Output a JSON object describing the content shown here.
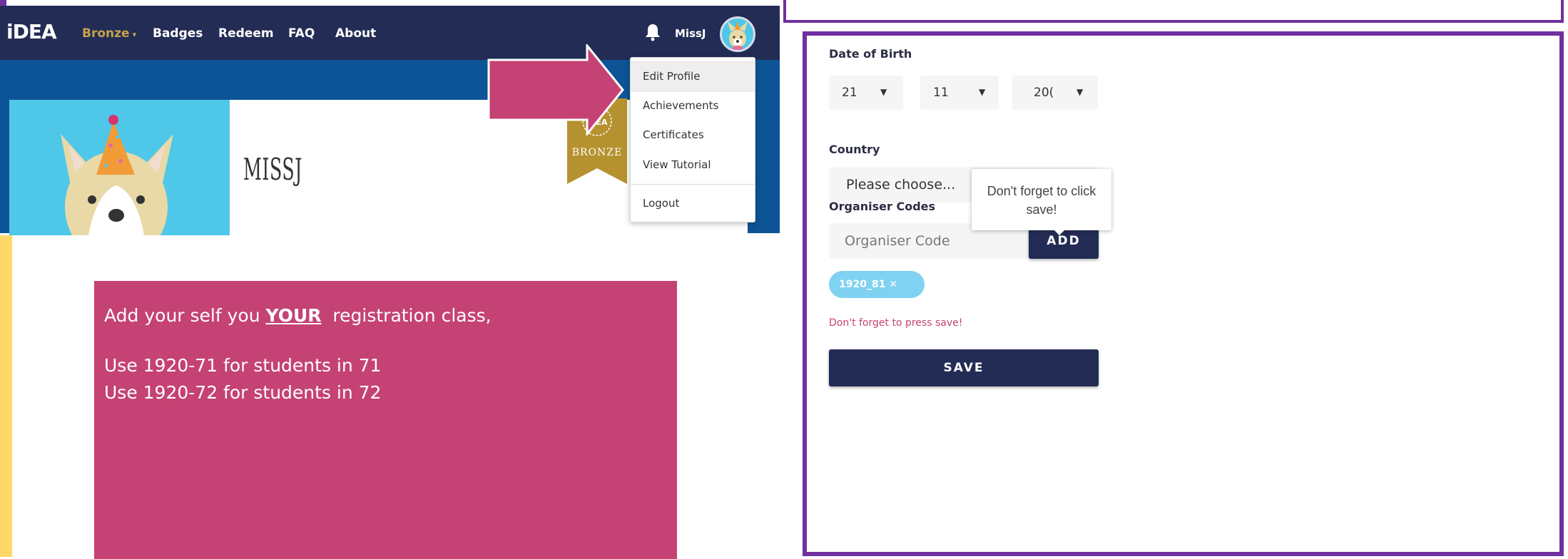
{
  "nav": {
    "logo": "iDEA",
    "level": "Bronze",
    "level_caret": "▾",
    "badges": "Badges",
    "redeem": "Redeem",
    "faq": "FAQ",
    "about": "About",
    "username": "MissJ"
  },
  "profile": {
    "name": "MISSJ",
    "ribbon_logo": "iDEA",
    "ribbon_level": "BRONZE"
  },
  "dropdown": {
    "items": [
      "Edit Profile",
      "Achievements",
      "Certificates",
      "View Tutorial"
    ],
    "logout": "Logout"
  },
  "message": {
    "line1_pre": "Add your self you ",
    "line1_emph": "YOUR",
    "line1_post": "  registration class,",
    "line2": "Use 1920-71 for students in 71",
    "line3": "Use 1920-72 for students in 72"
  },
  "form": {
    "dob_label": "Date of Birth",
    "dob_day": "21",
    "dob_month": "11",
    "dob_year": "20(",
    "country_label": "Country",
    "country_value": "Please choose...",
    "codes_label": "Organiser Codes",
    "code_placeholder": "Organiser Code",
    "add_label": "ADD",
    "tag": "1920_81",
    "tag_remove": "✕",
    "reminder": "Don't forget to press save!",
    "save_label": "SAVE"
  },
  "tooltip": {
    "text": "Don't forget to click save!"
  },
  "colors": {
    "navbar": "#232c55",
    "banner": "#0d5496",
    "accent_purple": "#7030a0",
    "message_bg": "#c54274",
    "bronze": "#c8a24a",
    "tag": "#7fd2f1"
  }
}
